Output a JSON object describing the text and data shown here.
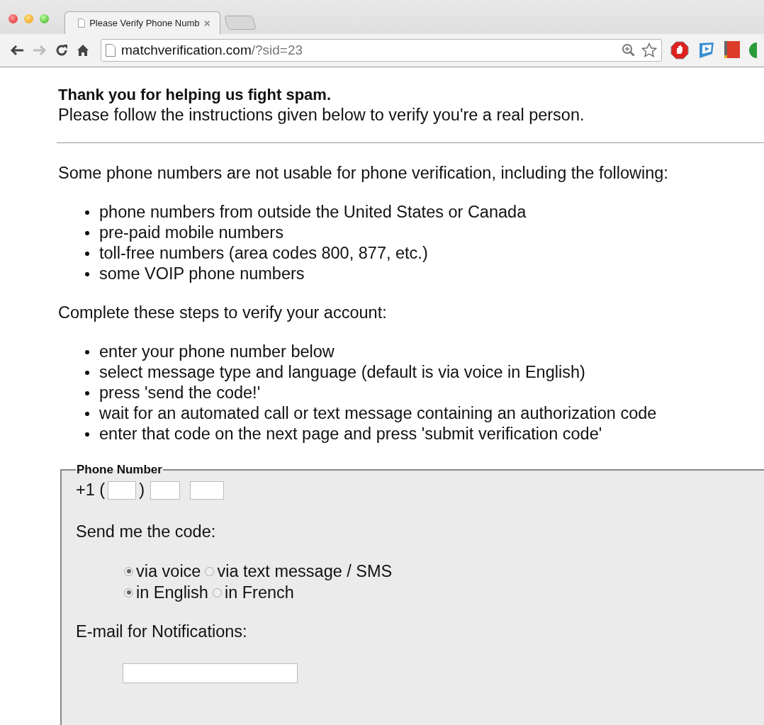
{
  "browser": {
    "tab": {
      "title": "Please Verify Phone Numb",
      "selected": true
    },
    "address": {
      "domain": "matchverification.com",
      "path": "/?sid=23"
    },
    "forward_disabled": true
  },
  "page": {
    "heading": "Thank you for helping us fight spam.",
    "subheading": "Please follow the instructions given below to verify you're a real person.",
    "notice": "Some phone numbers are not usable for phone verification, including the following:",
    "restrictions": [
      "phone numbers from outside the United States or Canada",
      "pre-paid mobile numbers",
      "toll-free numbers (area codes 800, 877, etc.)",
      "some VOIP phone numbers"
    ],
    "steps_intro": "Complete these steps to verify your account:",
    "steps": [
      "enter your phone number below",
      "select message type and language (default is via voice in English)",
      "press 'send the code!'",
      "wait for an automated call or text message containing an authorization code",
      "enter that code on the next page and press 'submit verification code'"
    ],
    "form": {
      "legend": "Phone Number",
      "phone_prefix": "+1 (",
      "phone_close": ")",
      "send_label": "Send me the code:",
      "method_options": [
        {
          "label": "via voice",
          "selected": true
        },
        {
          "label": "via text message / SMS",
          "selected": false
        }
      ],
      "language_options": [
        {
          "label": "in English",
          "selected": true
        },
        {
          "label": "in French",
          "selected": false
        }
      ],
      "email_label": "E-mail for Notifications:"
    }
  }
}
